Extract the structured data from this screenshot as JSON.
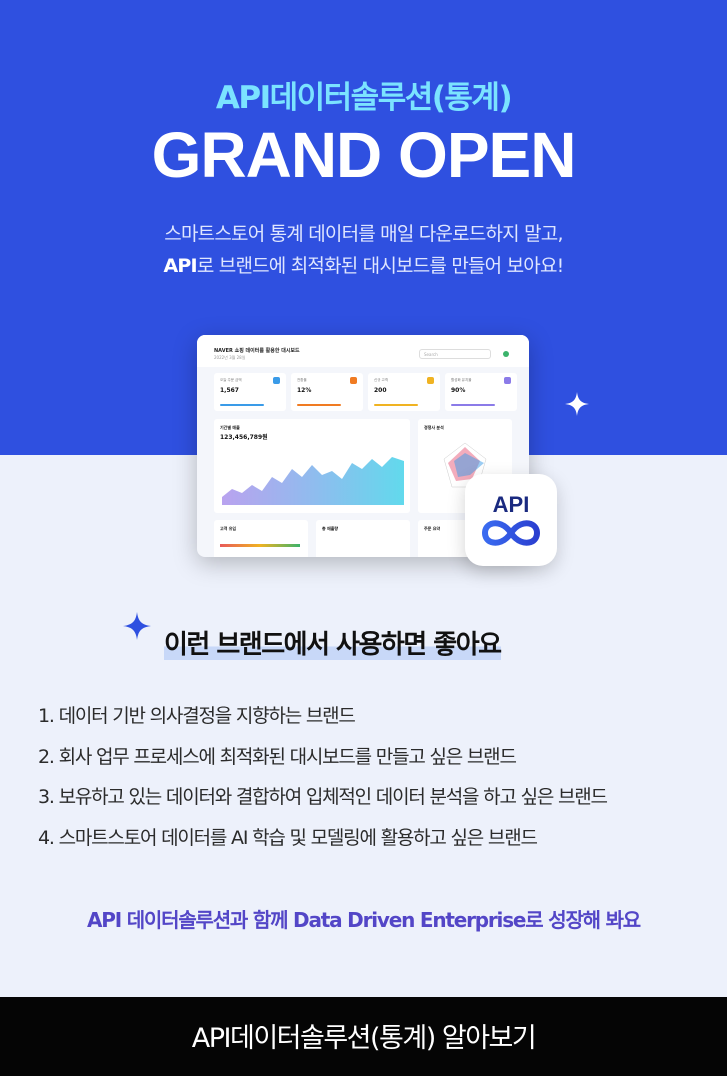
{
  "hero": {
    "subtitle": "API데이터솔루션(통계)",
    "headline": "GRAND OPEN",
    "desc_line1": "스마트스토어 통계 데이터를 매일 다운로드하지 말고,",
    "desc_line2_prefix": "API",
    "desc_line2_rest": "로 브랜드에 최적화된 대시보드를 만들어 보아요!"
  },
  "dashboard": {
    "title": "NAVER 쇼핑 데이터를 활용한 대시보드",
    "date": "2022년 3월 28일",
    "search_placeholder": "Search",
    "kpis": [
      {
        "label": "오늘 주문 금액",
        "value": "1,567",
        "color": "#3a9be8"
      },
      {
        "label": "전환율",
        "value": "12%",
        "color": "#f07b22"
      },
      {
        "label": "신규 고객",
        "value": "200",
        "color": "#f0b322"
      },
      {
        "label": "활성화 유지율",
        "value": "90%",
        "color": "#8b7be8"
      }
    ],
    "revenue_label": "기간별 매출",
    "revenue_value": "123,456,789원",
    "competitor_label": "경쟁사 분석",
    "inflow_label": "고객 유입",
    "sales_label": "총 매출량",
    "order_label": "주문 요약"
  },
  "badge": {
    "text": "API"
  },
  "section": {
    "title": "이런 브랜드에서 사용하면 좋아요",
    "items": [
      "1. 데이터 기반 의사결정을 지향하는 브랜드",
      "2. 회사 업무 프로세스에 최적화된 대시보드를 만들고 싶은 브랜드",
      "3. 보유하고 있는 데이터와 결합하여 입체적인 데이터 분석을 하고 싶은 브랜드",
      "4. 스마트스토어 데이터를 AI 학습 및 모델링에 활용하고 싶은 브랜드"
    ]
  },
  "tagline": "API 데이터솔루션과 함께  Data Driven Enterprise로 성장해 봐요",
  "footer": {
    "label": "API데이터솔루션(통계) 알아보기"
  },
  "colors": {
    "hero_bg": "#2f50e0",
    "accent_cyan": "#7be3ff",
    "lower_bg": "#edf1fb",
    "tagline": "#5346c7",
    "footer_bg": "#050505"
  }
}
